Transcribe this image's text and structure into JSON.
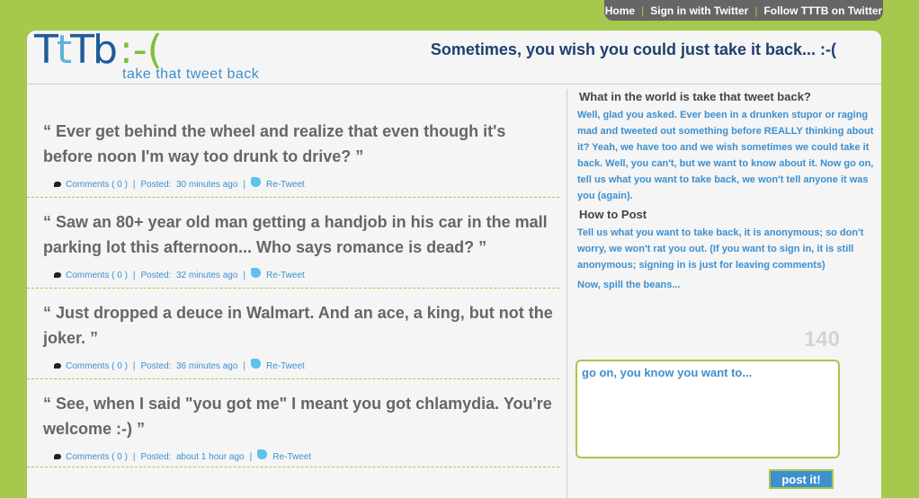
{
  "topnav": {
    "home": "Home",
    "signin": "Sign in with Twitter",
    "follow": "Follow TTTB on Twitter"
  },
  "header": {
    "logo_parts": [
      "T",
      "t",
      "T",
      "b",
      ":-("
    ],
    "tagline": "take that tweet back",
    "headline": "Sometimes, you wish you could just take it back... :-("
  },
  "tweets": [
    {
      "text": "“ Ever get behind the wheel and realize that even though it's before noon I'm way too drunk to drive? ”",
      "comments": "Comments ( 0 )",
      "posted_label": "Posted:",
      "posted": "30 minutes ago",
      "retweet": "Re-Tweet"
    },
    {
      "text": "“ Saw an 80+ year old man getting a handjob in his car in the mall parking lot this afternoon... Who says romance is dead? ”",
      "comments": "Comments ( 0 )",
      "posted_label": "Posted:",
      "posted": "32 minutes ago",
      "retweet": "Re-Tweet"
    },
    {
      "text": "“ Just dropped a deuce in Walmart. And an ace, a king, but not the joker. ”",
      "comments": "Comments ( 0 )",
      "posted_label": "Posted:",
      "posted": "36 minutes ago",
      "retweet": "Re-Tweet"
    },
    {
      "text": "“ See, when I said \"you got me\" I meant you got chlamydia. You're welcome :-) ”",
      "comments": "Comments ( 0 )",
      "posted_label": "Posted:",
      "posted": "about 1 hour ago",
      "retweet": "Re-Tweet"
    }
  ],
  "sidebar": {
    "what_title": "What in the world is take that tweet back?",
    "what_body": "Well, glad you asked. Ever been in a drunken stupor or raging mad and tweeted out something before REALLY thinking about it? Yeah, we have too and we wish sometimes we could take it back. Well, you can't, but we want to know about it. Now go on, tell us what you want to take back, we won't tell anyone it was you (again).",
    "how_title": "How to Post",
    "how_body": "Tell us what you want to take back, it is anonymous; so don't worry, we won't rat you out. (If you want to sign in, it is still anonymous; signing in is just for leaving comments)",
    "spill": "Now, spill the beans...",
    "counter": "140",
    "placeholder": "go on, you know you want to...",
    "post_button": "post it!"
  },
  "colors": {
    "background": "#a6c84c",
    "accent": "#3d8fcf",
    "headline": "#1f3f6e",
    "nav": "#666666"
  }
}
